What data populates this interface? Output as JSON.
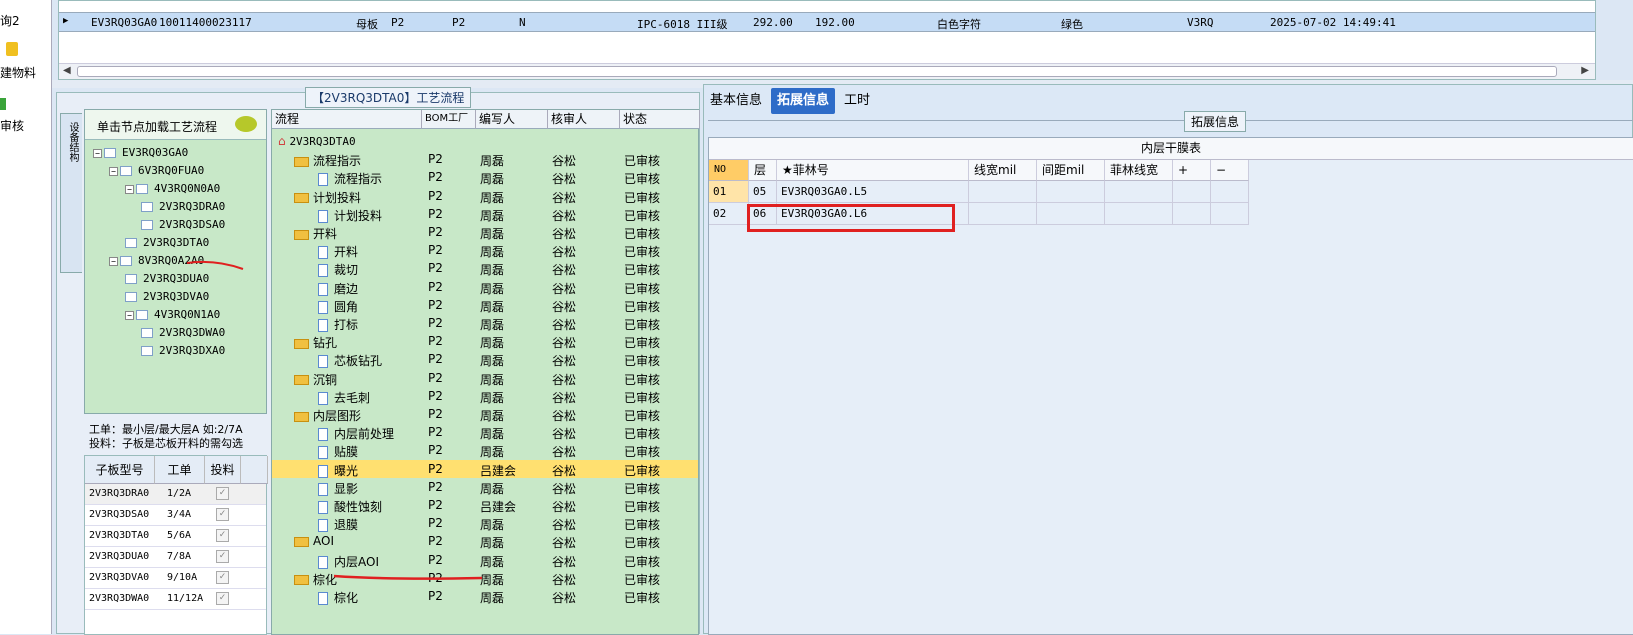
{
  "left_strip": {
    "items": [
      "询2",
      "建物料",
      "审核"
    ]
  },
  "top_grid": {
    "row": [
      "EV3RQ03GA0",
      "10011400023117",
      "母板",
      "P2",
      "P2",
      "N",
      "IPC-6018 III级",
      "292.00",
      "192.00",
      "白色字符",
      "绿色",
      "V3RQ",
      "2025-07-02 14:49:41"
    ]
  },
  "process_panel": {
    "title": "【2V3RQ3DTA0】工艺流程",
    "vtab": "设备结构",
    "node_header": "单击节点加载工艺流程",
    "nodes": [
      "EV3RQ03GA0",
      "6V3RQ0FUA0",
      "4V3RQ0N0A0",
      "2V3RQ3DRA0",
      "2V3RQ3DSA0",
      "2V3RQ3DTA0",
      "8V3RQ0A2A0",
      "2V3RQ3DUA0",
      "2V3RQ3DVA0",
      "4V3RQ0N1A0",
      "2V3RQ3DWA0",
      "2V3RQ3DXA0"
    ],
    "note1": "工单：最小层/最大层A 如:2/7A",
    "note2": "投料：子板是芯板开料的需勾选",
    "sub_headers": [
      "子板型号",
      "工单",
      "投料"
    ],
    "sub_rows": [
      [
        "2V3RQ3DRA0",
        "1/2A"
      ],
      [
        "2V3RQ3DSA0",
        "3/4A"
      ],
      [
        "2V3RQ3DTA0",
        "5/6A"
      ],
      [
        "2V3RQ3DUA0",
        "7/8A"
      ],
      [
        "2V3RQ3DVA0",
        "9/10A"
      ],
      [
        "2V3RQ3DWA0",
        "11/12A"
      ]
    ],
    "check_mark": "✓",
    "flow_headers": [
      "流程",
      "BOM工厂",
      "编写人",
      "核审人",
      "状态"
    ],
    "flow_rows": [
      [
        "2V3RQ3DTA0",
        "",
        "",
        "",
        ""
      ],
      [
        "流程指示",
        "P2",
        "周磊",
        "谷松",
        "已审核"
      ],
      [
        "流程指示",
        "P2",
        "周磊",
        "谷松",
        "已审核"
      ],
      [
        "计划投料",
        "P2",
        "周磊",
        "谷松",
        "已审核"
      ],
      [
        "计划投料",
        "P2",
        "周磊",
        "谷松",
        "已审核"
      ],
      [
        "开料",
        "P2",
        "周磊",
        "谷松",
        "已审核"
      ],
      [
        "开料",
        "P2",
        "周磊",
        "谷松",
        "已审核"
      ],
      [
        "裁切",
        "P2",
        "周磊",
        "谷松",
        "已审核"
      ],
      [
        "磨边",
        "P2",
        "周磊",
        "谷松",
        "已审核"
      ],
      [
        "圆角",
        "P2",
        "周磊",
        "谷松",
        "已审核"
      ],
      [
        "打标",
        "P2",
        "周磊",
        "谷松",
        "已审核"
      ],
      [
        "钻孔",
        "P2",
        "周磊",
        "谷松",
        "已审核"
      ],
      [
        "芯板钻孔",
        "P2",
        "周磊",
        "谷松",
        "已审核"
      ],
      [
        "沉铜",
        "P2",
        "周磊",
        "谷松",
        "已审核"
      ],
      [
        "去毛刺",
        "P2",
        "周磊",
        "谷松",
        "已审核"
      ],
      [
        "内层图形",
        "P2",
        "周磊",
        "谷松",
        "已审核"
      ],
      [
        "内层前处理",
        "P2",
        "周磊",
        "谷松",
        "已审核"
      ],
      [
        "贴膜",
        "P2",
        "周磊",
        "谷松",
        "已审核"
      ],
      [
        "曝光",
        "P2",
        "吕建会",
        "谷松",
        "已审核"
      ],
      [
        "显影",
        "P2",
        "周磊",
        "谷松",
        "已审核"
      ],
      [
        "酸性蚀刻",
        "P2",
        "吕建会",
        "谷松",
        "已审核"
      ],
      [
        "退膜",
        "P2",
        "周磊",
        "谷松",
        "已审核"
      ],
      [
        "AOI",
        "P2",
        "周磊",
        "谷松",
        "已审核"
      ],
      [
        "内层AOI",
        "P2",
        "周磊",
        "谷松",
        "已审核"
      ],
      [
        "棕化",
        "P2",
        "周磊",
        "谷松",
        "已审核"
      ],
      [
        "棕化",
        "P2",
        "周磊",
        "谷松",
        "已审核"
      ]
    ]
  },
  "right_panel": {
    "tabs": [
      "基本信息",
      "拓展信息",
      "工时"
    ],
    "section_title": "拓展信息",
    "table_title": "内层干膜表",
    "headers": [
      "NO",
      "层",
      "★菲林号",
      "线宽mil",
      "间距mil",
      "菲林线宽",
      "+",
      "−"
    ],
    "rows": [
      [
        "01",
        "05",
        "EV3RQ03GA0.L5"
      ],
      [
        "02",
        "06",
        "EV3RQ03GA0.L6"
      ]
    ]
  }
}
